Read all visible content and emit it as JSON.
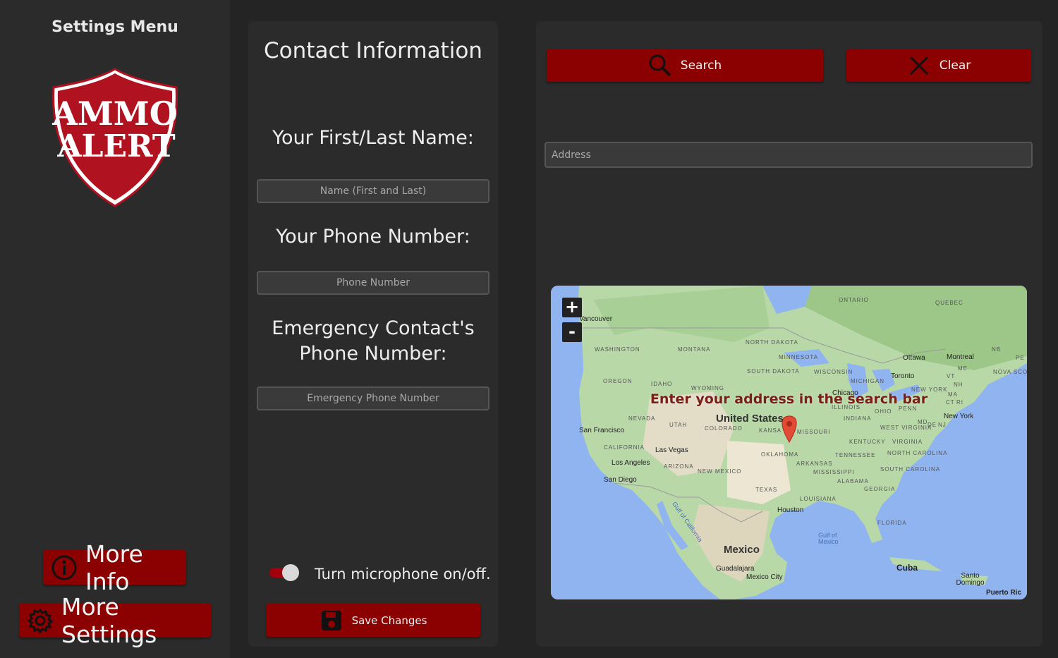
{
  "sidebar": {
    "title": "Settings Menu",
    "logo_text": [
      "AMMO",
      "ALERT"
    ],
    "more_info_label": "More Info",
    "more_settings_label": "More Settings"
  },
  "contact": {
    "heading": "Contact Information",
    "name_label": "Your First/Last Name:",
    "name_placeholder": "Name (First and Last)",
    "phone_label": "Your Phone Number:",
    "phone_placeholder": "Phone Number",
    "emergency_label_line1": "Emergency Contact's",
    "emergency_label_line2": "Phone Number:",
    "emergency_placeholder": "Emergency Phone Number",
    "microphone_label": "Turn microphone on/off.",
    "microphone_on": true,
    "save_label": "Save Changes"
  },
  "map_panel": {
    "search_label": "Search",
    "clear_label": "Clear",
    "address_placeholder": "Address",
    "overlay_text": "Enter your address in the search bar",
    "zoom_in": "+",
    "zoom_out": "-",
    "labels": {
      "countries": [
        "United States",
        "Mexico",
        "Cuba"
      ],
      "cities": [
        "Vancouver",
        "San Francisco",
        "Las Vegas",
        "Los Angeles",
        "San Diego",
        "Chicago",
        "Toronto",
        "Ottawa",
        "Montreal",
        "New York",
        "Houston",
        "Guadalajara",
        "Mexico City",
        "Santo Domingo",
        "Puerto Ric"
      ],
      "regions": [
        "ONTARIO",
        "QUEBEC",
        "WASHINGTON",
        "MONTANA",
        "NORTH DAKOTA",
        "MINNESOTA",
        "OREGON",
        "IDAHO",
        "SOUTH DAKOTA",
        "WISCONSIN",
        "MICHIGAN",
        "WYOMING",
        "NEVADA",
        "UTAH",
        "COLORADO",
        "KANSA",
        "MISSOURI",
        "ILLINOIS",
        "INDIANA",
        "OHIO",
        "PENN",
        "CALIFORNIA",
        "ARIZONA",
        "NEW MEXICO",
        "OKLAHOMA",
        "ARKANSAS",
        "TENNESSEE",
        "KENTUCKY",
        "WEST VIRGINIA",
        "VIRGINIA",
        "NORTH CAROLINA",
        "SOUTH CAROLINA",
        "MISSISSIPPI",
        "ALABAMA",
        "GEORGIA",
        "TEXAS",
        "LOUISIANA",
        "FLORIDA",
        "NEW YORK",
        "ME",
        "VT",
        "NH",
        "MA",
        "CT",
        "RI",
        "MD",
        "DE",
        "NJ",
        "NB",
        "NOVA SCO",
        "PE"
      ],
      "water": [
        "Gulf of California",
        "Gulf of Mexico"
      ]
    }
  }
}
